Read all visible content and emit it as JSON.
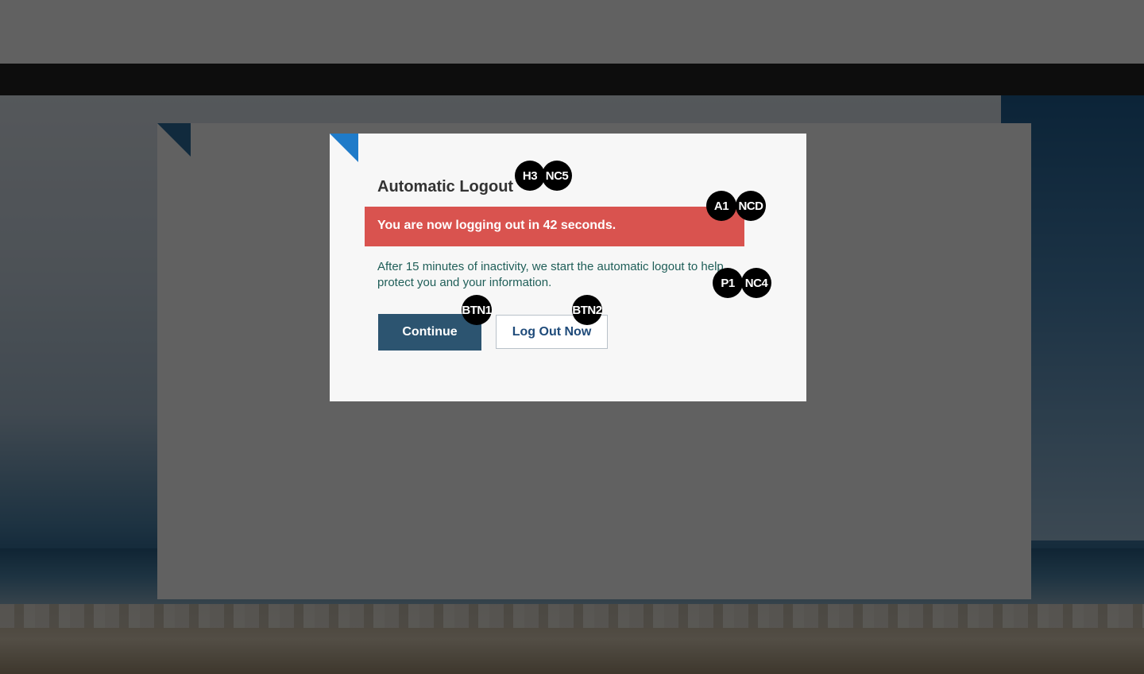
{
  "dialog": {
    "title": "Automatic Logout",
    "alert_text": "You are now logging out in 42 seconds.",
    "countdown_seconds": 42,
    "body_text": "After 15 minutes of inactivity, we start the automatic logout to help protect you and your information.",
    "continue_label": "Continue",
    "logout_label": "Log Out Now"
  },
  "badges": {
    "title_tag": "H3",
    "title_nc": "NC5",
    "alert_tag": "A1",
    "alert_nc": "NCD",
    "text_tag": "P1",
    "text_nc": "NC4",
    "continue_tag": "BTN1",
    "logout_tag": "BTN2"
  },
  "colors": {
    "alert_bg": "#d9534f",
    "primary_button": "#2c5470",
    "accent_corner": "#1f7bc9",
    "overlay": "rgba(0,0,0,0.62)"
  }
}
